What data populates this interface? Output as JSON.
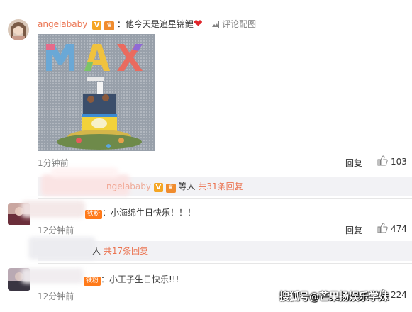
{
  "comments": [
    {
      "username": "angelababy",
      "colon": "：",
      "text": "他今天是追星锦鲤",
      "heart": "❤",
      "image_action": "评论配图",
      "image": {
        "letters": "MAX"
      },
      "time": "1分钟前",
      "reply_label": "回复",
      "likes": "103"
    },
    {
      "colon": "：",
      "text": "小海绵生日快乐！！！",
      "fan_label": "铁粉",
      "time": "12分钟前",
      "reply_label": "回复",
      "likes": "474"
    },
    {
      "colon": "：",
      "text": "小王子生日快乐!!!",
      "fan_label": "铁粉",
      "time": "12分钟前",
      "reply_label": "回复",
      "likes": "224"
    }
  ],
  "sub_replies": [
    {
      "name_fragment": "ngelababy",
      "suffix": "等人",
      "count_text": "共31条回复"
    },
    {
      "name_fragment": "人",
      "count_text": "共17条回复"
    }
  ],
  "watermark": "搜狐号@芒果扬娱乐学妹",
  "colors": {
    "accent": "#eb7350",
    "badge": "#f5a623",
    "heart": "#e0252b"
  },
  "icons": [
    "verified-badge-icon",
    "vip-badge-icon",
    "heart-icon",
    "picture-icon",
    "thumb-up-icon"
  ]
}
